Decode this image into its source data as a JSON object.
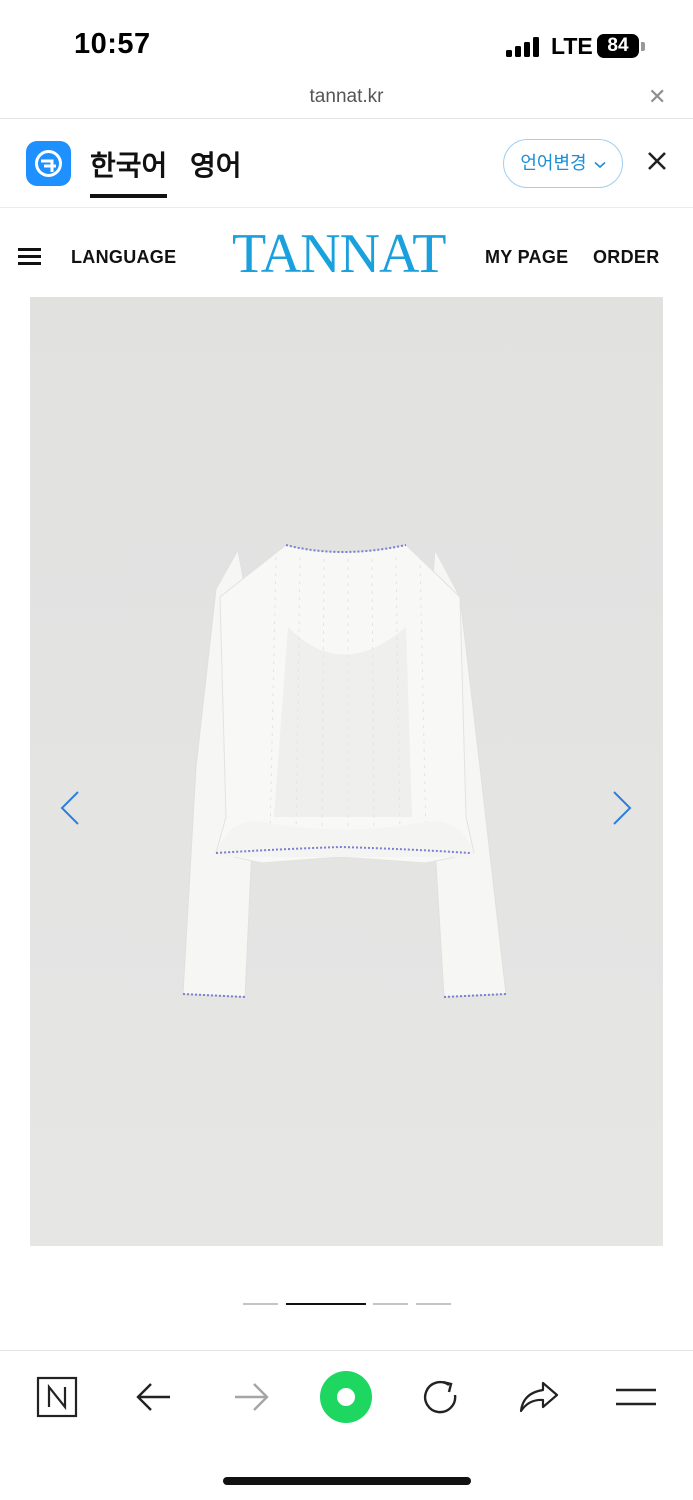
{
  "status": {
    "time": "10:57",
    "network": "LTE",
    "battery": "84"
  },
  "browser": {
    "url": "tannat.kr"
  },
  "translate": {
    "tab_korean": "한국어",
    "tab_english": "영어",
    "change_language": "언어변경"
  },
  "site": {
    "language_label": "LANGUAGE",
    "logo": "TANNAT",
    "mypage_label": "MY PAGE",
    "order_label": "ORDER"
  },
  "gallery": {
    "slide_count": 4,
    "active_slide": 2
  },
  "colors": {
    "brand": "#1aa0dc",
    "arrow": "#2f7fe0",
    "papago": "#1e90ff",
    "go_button": "#1ed760"
  },
  "icons": [
    "papago-icon",
    "close-icon",
    "hamburger-icon",
    "chevron-left-icon",
    "chevron-right-icon",
    "naver-icon",
    "back-icon",
    "forward-icon",
    "green-dot-icon",
    "reload-icon",
    "share-icon",
    "menu-icon"
  ]
}
